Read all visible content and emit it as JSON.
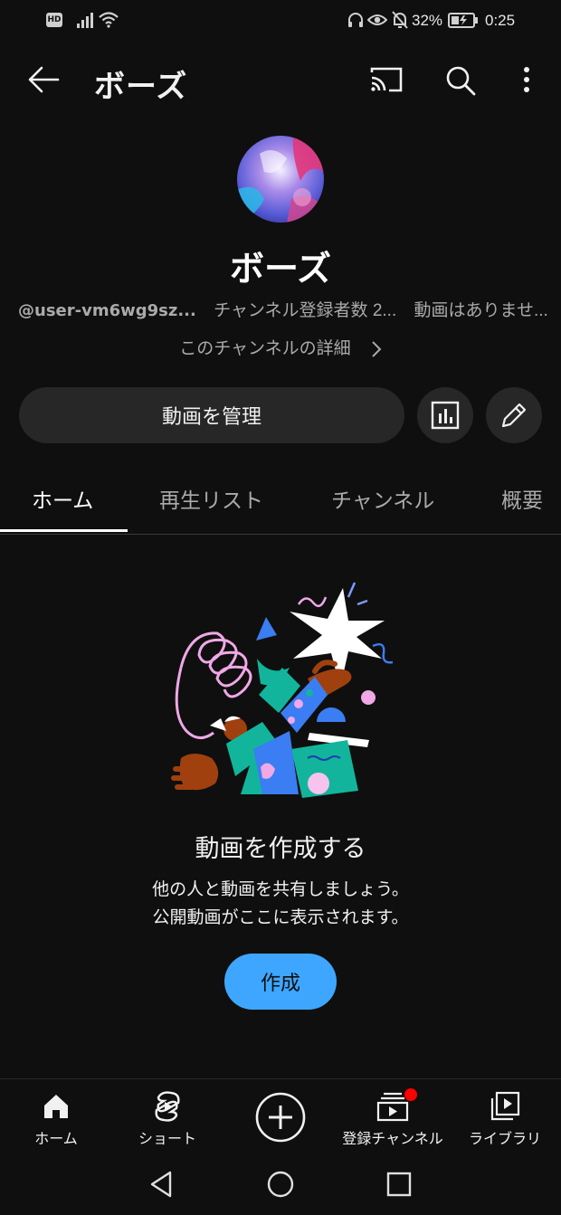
{
  "status_bar": {
    "hd_badge": "HD",
    "battery_percent": "32%",
    "time": "0:25"
  },
  "app_bar": {
    "title": "ボーズ",
    "icons": [
      "back-arrow-icon",
      "cast-icon",
      "search-icon",
      "more-vert-icon"
    ]
  },
  "channel": {
    "name": "ボーズ",
    "handle": "@user-vm6wg9sz...",
    "subscribers": "チャンネル登録者数 2...",
    "videos": "動画はありませ...",
    "details_link": "このチャンネルの詳細"
  },
  "actions": {
    "manage_videos": "動画を管理",
    "analytics_icon": "bar-chart-icon",
    "edit_icon": "pencil-icon"
  },
  "tabs": [
    {
      "label": "ホーム",
      "active": true
    },
    {
      "label": "再生リスト",
      "active": false
    },
    {
      "label": "チャンネル",
      "active": false
    },
    {
      "label": "概要",
      "active": false
    }
  ],
  "empty_state": {
    "title": "動画を作成する",
    "line1": "他の人と動画を共有しましょう。",
    "line2": "公開動画がここに表示されます。",
    "create_button": "作成"
  },
  "bottom_nav": [
    {
      "label": "ホーム",
      "icon": "home-icon"
    },
    {
      "label": "ショート",
      "icon": "shorts-icon"
    },
    {
      "label": "",
      "icon": "create-plus-icon"
    },
    {
      "label": "登録チャンネル",
      "icon": "subscriptions-icon",
      "badge": true
    },
    {
      "label": "ライブラリ",
      "icon": "library-icon"
    }
  ],
  "colors": {
    "background": "#0f0f0f",
    "surface": "#272727",
    "accent_blue": "#3ea6ff",
    "notification_red": "#ff0000"
  }
}
